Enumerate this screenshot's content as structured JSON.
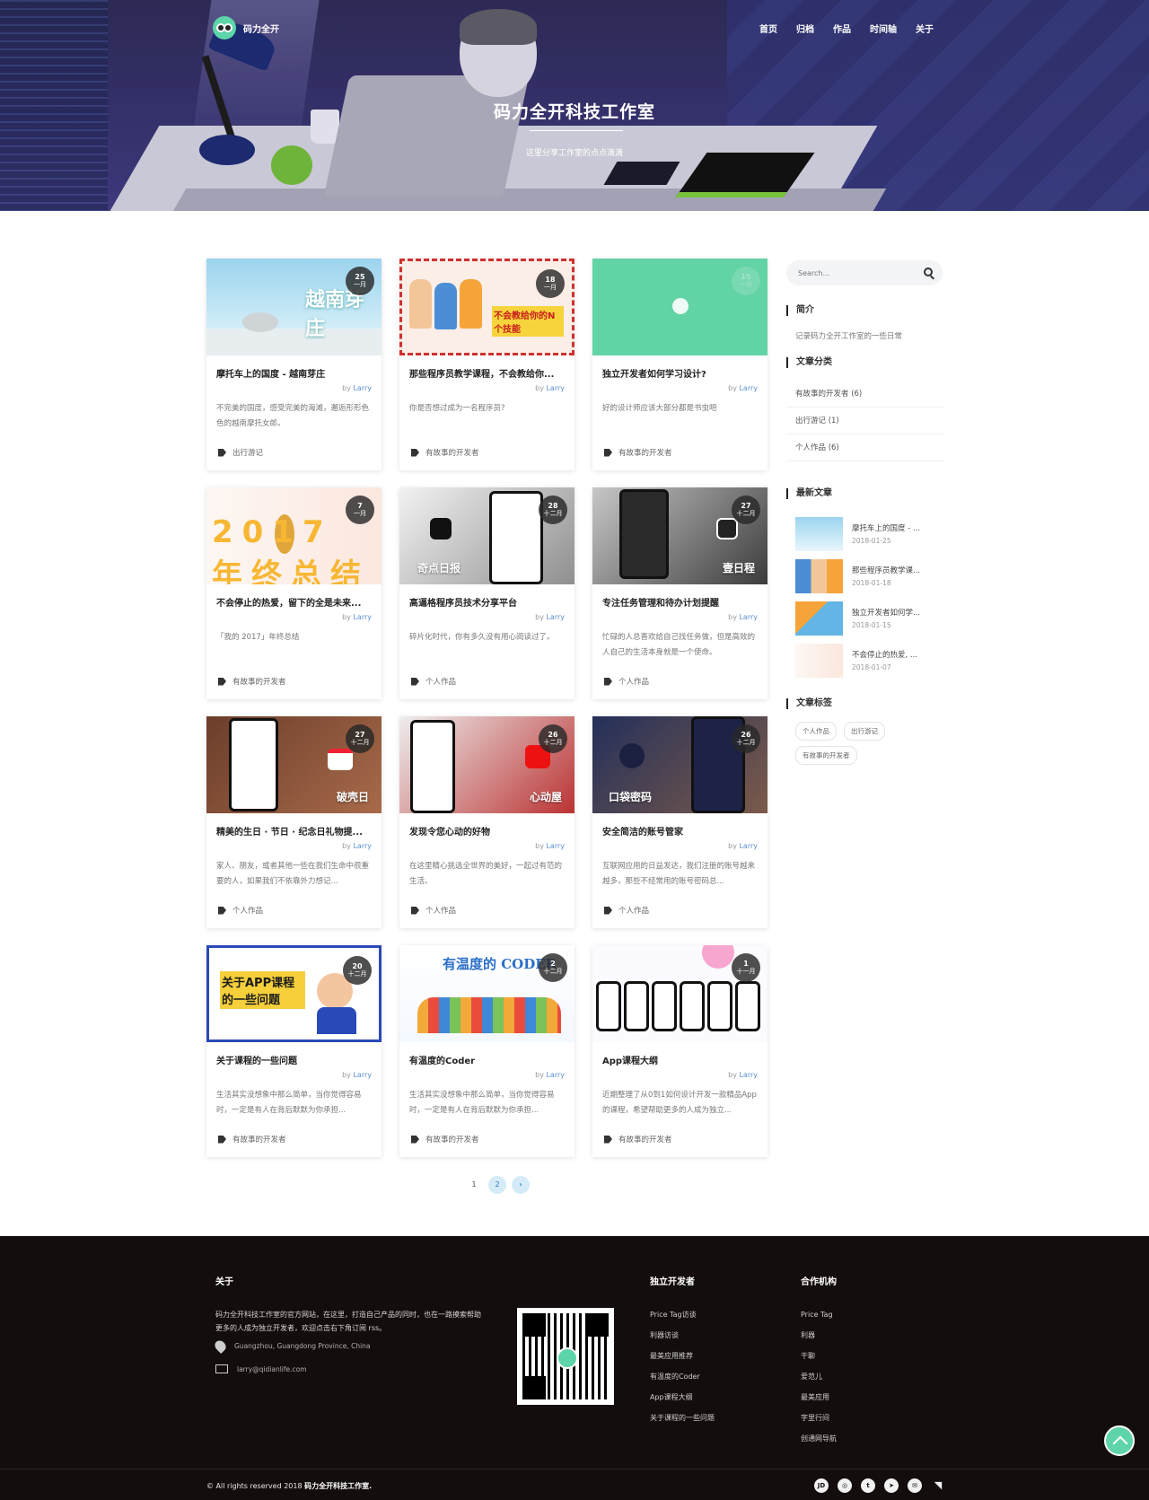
{
  "nav": {
    "brand": "码力全开",
    "menu": [
      "首页",
      "归档",
      "作品",
      "时间轴",
      "关于"
    ]
  },
  "hero": {
    "title": "码力全开科技工作室",
    "subtitle": "这里分享工作室的点点滴滴"
  },
  "posts": [
    {
      "title": "摩托车上的国度 - 越南芽庄",
      "author": "Larry",
      "excerpt": "不完美的国度，感受完美的海滩，邂逅形形色色的越南摩托女郎。",
      "category": "出行游记",
      "day": "25",
      "month": "一月",
      "img_text": "越南芽庄",
      "icon": "beach-illustration"
    },
    {
      "title": "那些程序员教学课程，不会教给你...",
      "author": "Larry",
      "excerpt": "你是否想过成为一名程序员?",
      "category": "有故事的开发者",
      "day": "18",
      "month": "一月",
      "img_text": "不会教给你的N个技能",
      "icon": "programmers-illustration"
    },
    {
      "title": "独立开发者如何学习设计?",
      "author": "Larry",
      "excerpt": "好的设计师应该大部分都是书虫吧",
      "category": "有故事的开发者",
      "day": "15",
      "month": "一月",
      "img_text": "",
      "icon": "share-icon"
    },
    {
      "title": "不会停止的热爱，留下的全是未来...",
      "author": "Larry",
      "excerpt": "「我的 2017」年终总结",
      "category": "有故事的开发者",
      "day": "7",
      "month": "一月",
      "img_text": "2017 年终总结",
      "icon": "pineapple-illustration"
    },
    {
      "title": "高逼格程序员技术分享平台",
      "author": "Larry",
      "excerpt": "碎片化时代，你有多久没有用心阅读过了。",
      "category": "个人作品",
      "day": "28",
      "month": "十二月",
      "img_text": "奇点日报",
      "icon": "app-logo-icon"
    },
    {
      "title": "专注任务管理和待办计划提醒",
      "author": "Larry",
      "excerpt": "忙碌的人总喜欢给自己找任务做，但是高效的人自己的生活本身就是一个使命。",
      "category": "个人作品",
      "day": "27",
      "month": "十二月",
      "img_text": "壹日程",
      "icon": "check-icon"
    },
    {
      "title": "精美的生日 · 节日 · 纪念日礼物提...",
      "author": "Larry",
      "excerpt": "家人、朋友，或者其他一些在我们生命中很重要的人，如果我们不依靠外力想记...",
      "category": "个人作品",
      "day": "27",
      "month": "十二月",
      "img_text": "破壳日",
      "icon": "date-icon"
    },
    {
      "title": "发现令您心动的好物",
      "author": "Larry",
      "excerpt": "在这里精心挑选全世界的美好，一起过有范的生活。",
      "category": "个人作品",
      "day": "26",
      "month": "十二月",
      "img_text": "心动屋",
      "icon": "heart-shop-icon"
    },
    {
      "title": "安全简洁的账号管家",
      "author": "Larry",
      "excerpt": "互联网应用的日益发达，我们注册的账号越来越多，那些不经常用的账号密码总...",
      "category": "个人作品",
      "day": "26",
      "month": "十二月",
      "img_text": "口袋密码",
      "icon": "lock-icon"
    },
    {
      "title": "关于课程的一些问题",
      "author": "Larry",
      "excerpt": "生活其实没想象中那么简单，当你觉得容易时，一定是有人在背后默默为你承担...",
      "category": "有故事的开发者",
      "day": "20",
      "month": "十二月",
      "img_text": "关于APP课程的一些问题",
      "icon": "course-illustration"
    },
    {
      "title": "有温度的Coder",
      "author": "Larry",
      "excerpt": "生活其实没想象中那么简单，当你觉得容易时，一定是有人在背后默默为你承担...",
      "category": "有故事的开发者",
      "day": "2",
      "month": "十二月",
      "img_text": "有温度的 CODER",
      "icon": "coder-illustration"
    },
    {
      "title": "App课程大纲",
      "author": "Larry",
      "excerpt": "近期整理了从0到1如何设计开发一款精品App的课程，希望帮助更多的人成为独立...",
      "category": "有故事的开发者",
      "day": "1",
      "month": "十一月",
      "img_text": "",
      "icon": "phones-illustration"
    }
  ],
  "pagination": {
    "pages": [
      "1",
      "2"
    ],
    "current": "2",
    "next": "›"
  },
  "sidebar": {
    "search_placeholder": "Search...",
    "intro_title": "简介",
    "intro_text": "记录码力全开工作室的一些日常",
    "categories_title": "文章分类",
    "categories": [
      "有故事的开发者 (6)",
      "出行游记 (1)",
      "个人作品 (6)"
    ],
    "recent_title": "最新文章",
    "recent": [
      {
        "title": "摩托车上的国度 - ...",
        "date": "2018-01-25"
      },
      {
        "title": "那些程序员教学课...",
        "date": "2018-01-18"
      },
      {
        "title": "独立开发者如何学...",
        "date": "2018-01-15"
      },
      {
        "title": "不会停止的热爱, ...",
        "date": "2018-01-07"
      }
    ],
    "tags_title": "文章标签",
    "tags": [
      "个人作品",
      "出行游记",
      "有故事的开发者"
    ]
  },
  "footer": {
    "about_title": "关于",
    "about_text": "码力全开科技工作室的官方网站，在这里，打造自己产品的同时，也在一路摸索帮助更多的人成为独立开发者，欢迎点击右下角订阅 rss。",
    "location": "Guangzhou, Guangdong Province, China",
    "email": "larry@qidianlife.com",
    "indie_title": "独立开发者",
    "indie_links": [
      "Price Tag访谈",
      "利器访谈",
      "最美应用推荐",
      "有温度的Coder",
      "App课程大纲",
      "关于课程的一些问题"
    ],
    "partners_title": "合作机构",
    "partner_links": [
      "Price Tag",
      "利器",
      "干聊",
      "爱范儿",
      "最美应用",
      "字里行间",
      "创通网导航"
    ],
    "copyright_prefix": "© All rights reserved 2018",
    "copyright_name": "码力全开科技工作室.",
    "socials": [
      "jd-icon",
      "weibo-icon",
      "twitter-icon",
      "telegram-icon",
      "message-icon",
      "rss-icon"
    ]
  },
  "colors": {
    "accent": "#5dd5a9",
    "footer_bg": "#140d0d",
    "link": "#5a8ed0"
  }
}
